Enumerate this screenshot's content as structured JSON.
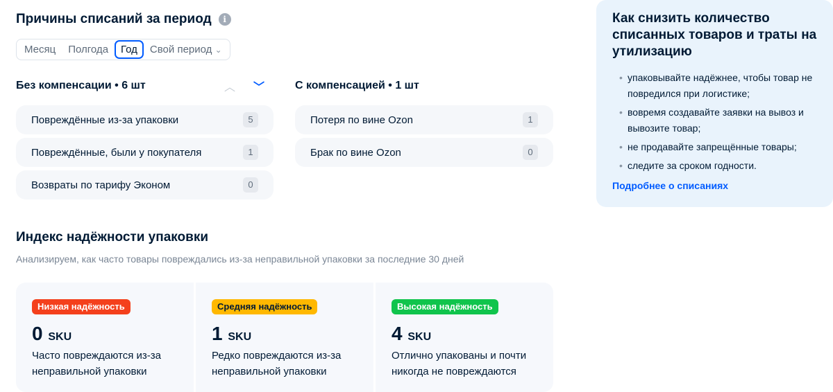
{
  "reasons": {
    "title": "Причины списаний за период",
    "periods": [
      "Месяц",
      "Полгода",
      "Год",
      "Свой период"
    ],
    "active_period": "Год",
    "without": {
      "title": "Без компенсации • 6 шт",
      "items": [
        {
          "label": "Повреждённые из-за упаковки",
          "count": "5"
        },
        {
          "label": "Повреждённые, были у покупателя",
          "count": "1"
        },
        {
          "label": "Возвраты по тарифу Эконом",
          "count": "0"
        }
      ]
    },
    "with": {
      "title": "С компенсацией • 1 шт",
      "items": [
        {
          "label": "Потеря по вине Ozon",
          "count": "1"
        },
        {
          "label": "Брак по вине Ozon",
          "count": "0"
        }
      ]
    }
  },
  "index": {
    "title": "Индекс надёжности упаковки",
    "subtitle": "Анализируем, как часто товары повреждались из-за неправильной упаковки за последние 30 дней",
    "cards": [
      {
        "tag": "Низкая надёжность",
        "color": "#f4401c",
        "value": "0",
        "unit": "SKU",
        "desc": "Часто повреждаются из-за неправильной упаковки"
      },
      {
        "tag": "Средняя надёжность",
        "color": "#ffb800",
        "value": "1",
        "unit": "SKU",
        "desc": "Редко повреждаются из-за неправильной упаковки"
      },
      {
        "tag": "Высокая надёжность",
        "color": "#10c44c",
        "value": "4",
        "unit": "SKU",
        "desc": "Отлично упакованы и почти никогда не повреждаются"
      }
    ]
  },
  "tips": {
    "title": "Как снизить количество списанных товаров и траты на утилизацию",
    "items": [
      "упаковывайте надёжнее, чтобы товар не повредился при логистике;",
      "вовремя создавайте заявки на вывоз и вывозите товар;",
      "не продавайте запрещённые товары;",
      "следите за сроком годности."
    ],
    "link": "Подробнее о списаниях"
  }
}
